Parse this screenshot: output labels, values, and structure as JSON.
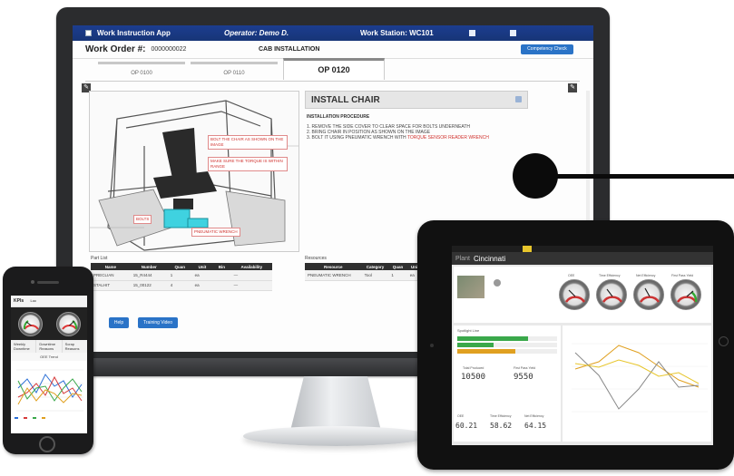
{
  "monitor": {
    "app_title": "Work Instruction App",
    "operator": "Operator: Demo D.",
    "station": "Work Station: WC101",
    "work_order_label": "Work Order #:",
    "work_order_value": "0000000022",
    "section_title": "CAB INSTALLATION",
    "competency_button": "Competency Check",
    "tabs": [
      "OP 0100",
      "OP 0110",
      "OP 0120"
    ],
    "instruction_title": "INSTALL CHAIR",
    "procedure_label": "INSTALLATION PROCEDURE",
    "procedure_text": "1. REMOVE THE SIDE COVER TO CLEAR SPACE FOR BOLTS UNDERNEATH\n2. BRING CHAIR IN POSITION AS SHOWN ON THE IMAGE\n3. BOLT IT USING PNEUMATIC WRENCH WITH ",
    "procedure_highlight": "TORQUE SENSOR READER WRENCH",
    "callouts": {
      "bolt_chair": "BOLT THE CHAIR AS SHOWN ON THE IMAGE",
      "torque": "MAKE SURE THE TORQUE IS WITHIN RANGE",
      "bolts": "BOLTS",
      "wrench": "PNEUMATIC WRENCH"
    },
    "part_list_label": "Part List",
    "part_headers": [
      "Name",
      "Number",
      "Quan",
      "Unit",
      "Bin",
      "Availability"
    ],
    "parts": [
      {
        "name": "PRECLIAN",
        "number": "15_R4444",
        "quan": "1",
        "unit": "ea",
        "bin": "",
        "avail": "—"
      },
      {
        "name": "STALHIT",
        "number": "15_00122",
        "quan": "4",
        "unit": "ea",
        "bin": "",
        "avail": "—"
      }
    ],
    "resources_label": "Resources",
    "resource_headers": [
      "Resource",
      "Category",
      "Quan",
      "Unit"
    ],
    "resources": [
      {
        "resource": "PNEUMATIC WRENCH",
        "category": "Tool",
        "quan": "1",
        "unit": "ea"
      }
    ],
    "help_button": "Help",
    "training_button": "Training Video"
  },
  "phone": {
    "title": "KPIs",
    "subtitle": "Loc",
    "chart_title": "OEE Trend",
    "tabs": [
      "Weekly Downtime",
      "Downtime Reasons",
      "Scrap Reasons"
    ]
  },
  "tablet": {
    "plant_label": "Plant",
    "plant_name": "Cincinnati",
    "gauges": [
      "OEE",
      "Time Efficiency",
      "Net Efficiency",
      "First Pass Yield"
    ],
    "spotlight_label": "Spotlight Line",
    "total_produced_label": "Total Produced",
    "total_produced": "10500",
    "first_pass_label": "First Pass Yield",
    "first_pass": "9550",
    "oee_label": "OEE",
    "oee_value": "60.21",
    "time_eff_label": "Time Efficiency",
    "time_eff_value": "58.62",
    "net_eff_label": "Net Efficiency",
    "net_eff_value": "64.15"
  },
  "colors": {
    "app_blue": "#1c3d8f",
    "button_blue": "#2a73c7",
    "callout_red": "#d0312d",
    "tablet_yellow": "#e7c52b"
  }
}
